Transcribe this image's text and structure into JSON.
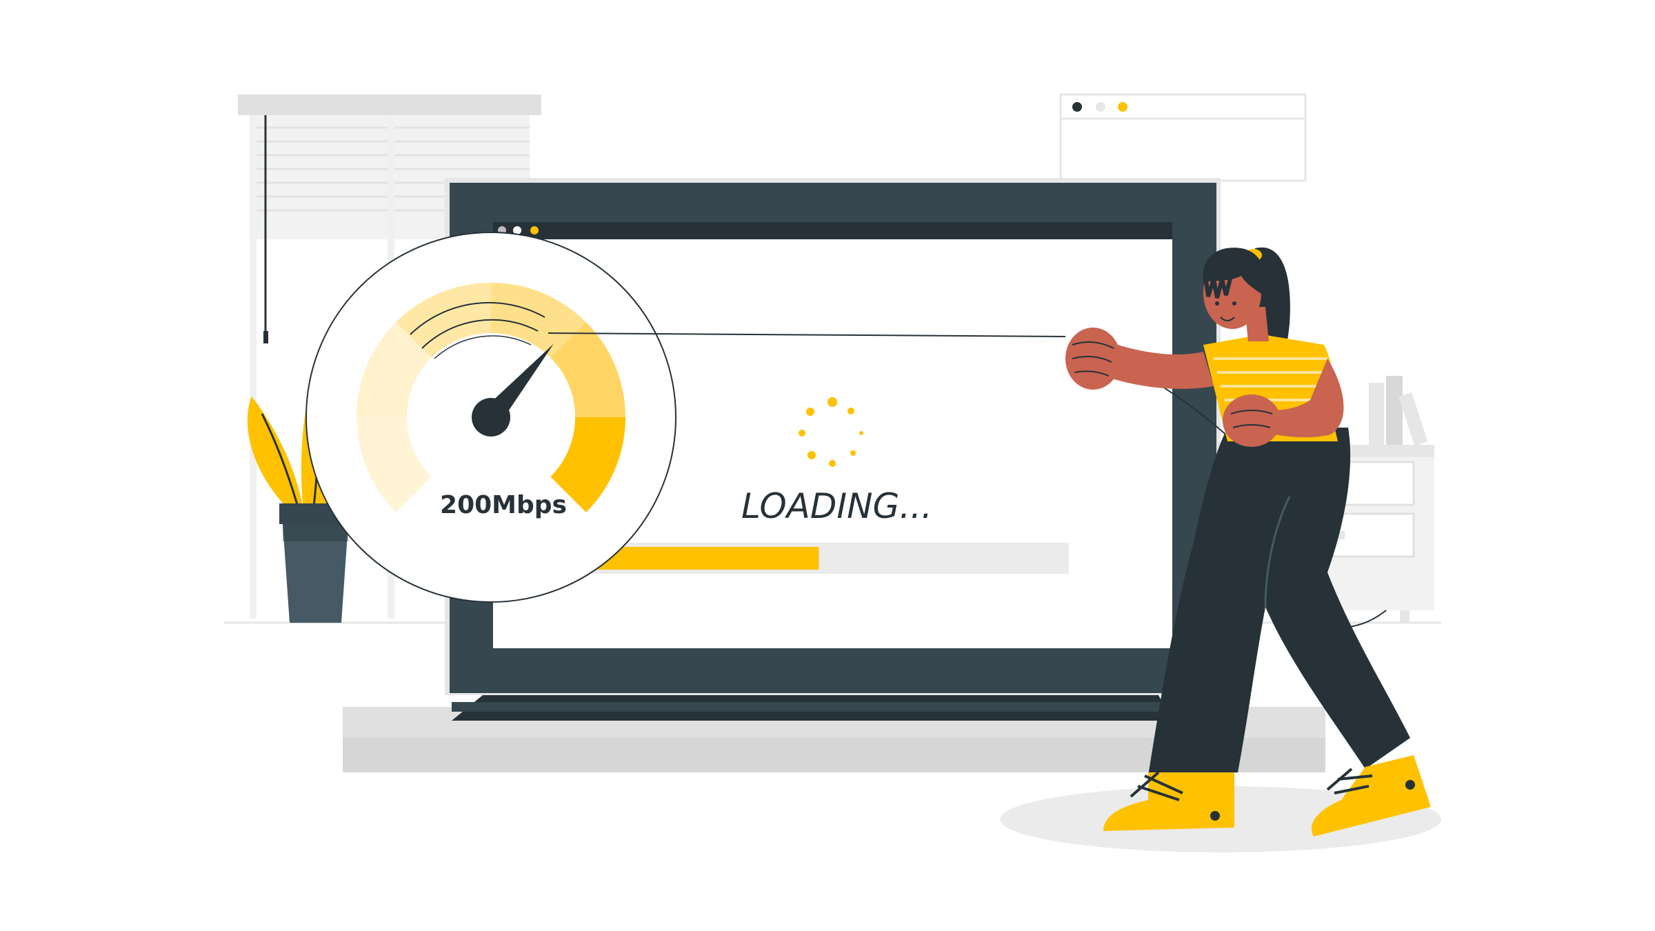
{
  "screen": {
    "status_text": "LOADING...",
    "progress_fraction": 0.51
  },
  "speedometer": {
    "speed_label": "200Mbps",
    "needle_level": 0.65
  },
  "browser_controls": {
    "dot_colors": [
      "#bdbdbd",
      "#ffffff",
      "#ffc100"
    ]
  },
  "colors": {
    "accent": "#ffc100",
    "dark": "#263238",
    "light_gray": "#e6e6e6",
    "skin": "#c86450"
  },
  "icons": [
    "speedometer-icon",
    "loading-spinner-icon",
    "browser-window-icon",
    "plant-icon"
  ]
}
